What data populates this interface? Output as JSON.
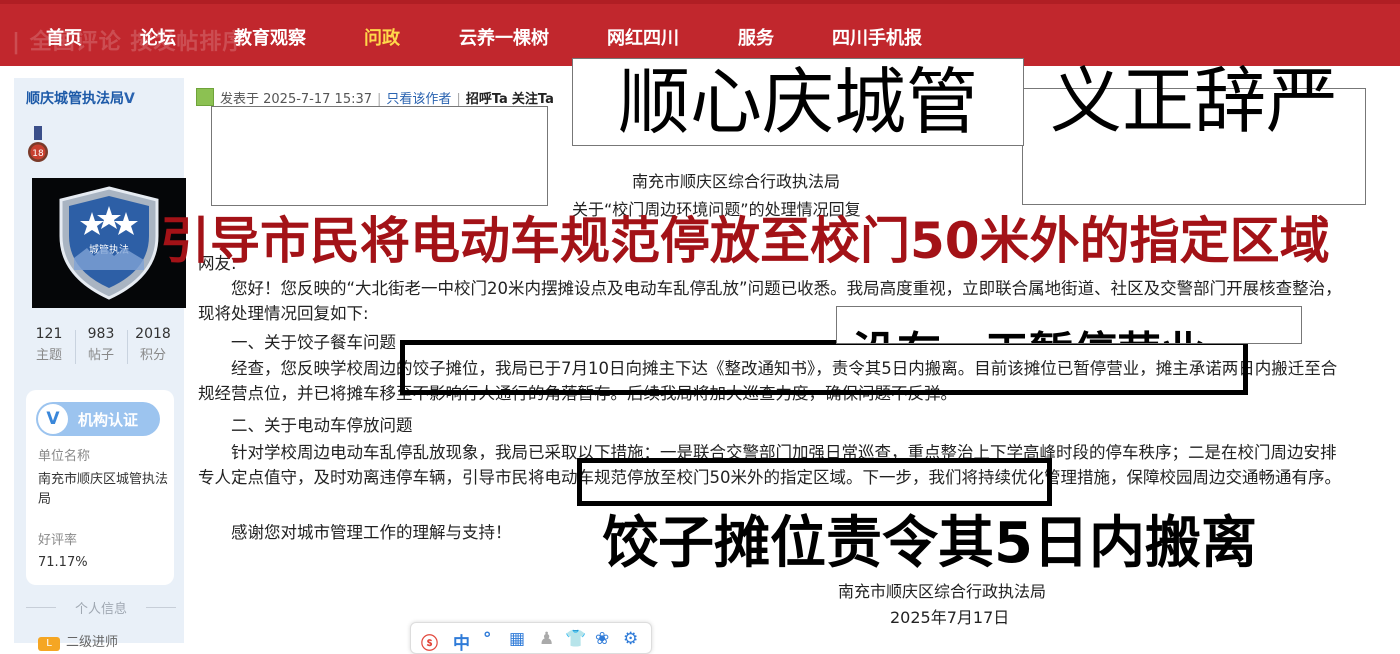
{
  "nav": {
    "ghost_text": "| 全国评论 按发帖排序",
    "items": [
      {
        "label": "首页",
        "active": false
      },
      {
        "label": "论坛",
        "active": false
      },
      {
        "label": "教育观察",
        "active": false
      },
      {
        "label": "问政",
        "active": true
      },
      {
        "label": "云养一棵树",
        "active": false
      },
      {
        "label": "网红四川",
        "active": false
      },
      {
        "label": "服务",
        "active": false
      },
      {
        "label": "四川手机报",
        "active": false
      }
    ]
  },
  "sidebar": {
    "username": "顺庆城管执法局",
    "verified_mark": "V",
    "medal_number": "18",
    "avatar_text": "城管执法",
    "stats": [
      {
        "value": "121",
        "label": "主题"
      },
      {
        "value": "983",
        "label": "帖子"
      },
      {
        "value": "2018",
        "label": "积分"
      }
    ],
    "cert_button": "机构认证",
    "unit_label": "单位名称",
    "unit_value": "南充市顺庆区城管执法局",
    "rating_label": "好评率",
    "rating_value": "71.17%",
    "personal_header": "个人信息",
    "level_text": "二级进师"
  },
  "post": {
    "meta_prefix": "发表于 2025-7-17 15:37",
    "only_author": "只看该作者",
    "greet": "招呼Ta",
    "follow": "关注Ta",
    "org_top": "南充市顺庆区综合行政执法局",
    "subject": "关于“校门周边环境问题”的处理情况回复",
    "salutation": "网友:",
    "paragraphs": [
      "　　您好！您反映的“大北街老一中校门20米内摆摊设点及电动车乱停乱放”问题已收悉。我局高度重视，立即联合属地街道、社区及交警部门开展核查整治，现将处理情况回复如下:",
      "　　一、关于饺子餐车问题",
      "　　经查，您反映学校周边的饺子摊位，我局已于7月10日向摊主下达《整改通知书》，责令其5日内搬离。目前该摊位已暂停营业，摊主承诺两日内搬迁至合规经营点位，并已将摊车移至不影响行人通行的角落暂存。后续我局将加大巡查力度，确保问题不反弹。",
      "　　二、关于电动车停放问题",
      "　　针对学校周边电动车乱停乱放现象，我局已采取以下措施：一是联合交警部门加强日常巡查，重点整治上下学高峰时段的停车秩序；二是在校门周边安排专人定点值守，及时劝离违停车辆，引导市民将电动车规范停放至校门50米外的指定区域。下一步，我们将持续优化管理措施，保障校园周边交通畅通有序。",
      "　　感谢您对城市管理工作的理解与支持！"
    ],
    "sign_org": "南充市顺庆区综合行政执法局",
    "sign_date": "2025年7月17日"
  },
  "overlays": {
    "title_left": "顺心庆城管",
    "title_right": "义正辞严",
    "red_caption": "引导市民将电动车规范停放至校门50米外的指定区域",
    "ghost_caption": "没有一天暂停营业",
    "black_caption": "饺子摊位责令其5日内搬离"
  },
  "toolbar": {
    "icons": [
      "app-icon",
      "language-icon",
      "dots-icon",
      "keyboard-icon",
      "user-icon",
      "shirt-icon",
      "spiral-icon",
      "gear-icon"
    ],
    "glyphs": [
      "ⓢ",
      "中",
      "°",
      "▦",
      "♟",
      "👕",
      "❀",
      "⚙"
    ]
  },
  "colors": {
    "nav_bg": "#c1272d",
    "nav_active": "#ffd84a",
    "sidebar_bg": "#e9f0f8",
    "link": "#2a63b0",
    "red_caption": "#a31217"
  }
}
